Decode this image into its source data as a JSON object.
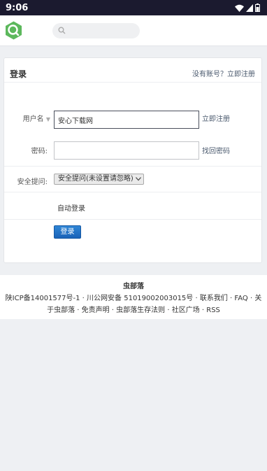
{
  "status_bar": {
    "time": "9:06",
    "icons": [
      "wifi-icon",
      "cell-signal-icon",
      "battery-icon"
    ]
  },
  "header": {
    "logo": "logo-icon",
    "search": {
      "placeholder": ""
    }
  },
  "login": {
    "title": "登录",
    "no_account_text": "没有账号？",
    "register_link": "立即注册",
    "username_label": "用户名",
    "username_value": "安心下载网",
    "username_register_link": "立即注册",
    "password_label": "密码:",
    "password_value": "",
    "forgot_password_link": "找回密码",
    "security_question_label": "安全提问:",
    "security_question_selected": "安全提问(未设置请忽略)",
    "auto_login_label": "自动登录",
    "login_button": "登录"
  },
  "footer": {
    "site_name": "虫部落",
    "icp": "陕ICP备14001577号-1",
    "police": "川公网安备 51019002003015号",
    "links": [
      "联系我们",
      "FAQ",
      "关于虫部落",
      "免责声明",
      "虫部落生存法则",
      "社区广场",
      "RSS"
    ]
  },
  "colors": {
    "status_bar_bg": "#1b1a2f",
    "logo_green": "#5cb85c",
    "button_blue": "#1a63b8",
    "link_gray_blue": "#4b5a6e"
  }
}
